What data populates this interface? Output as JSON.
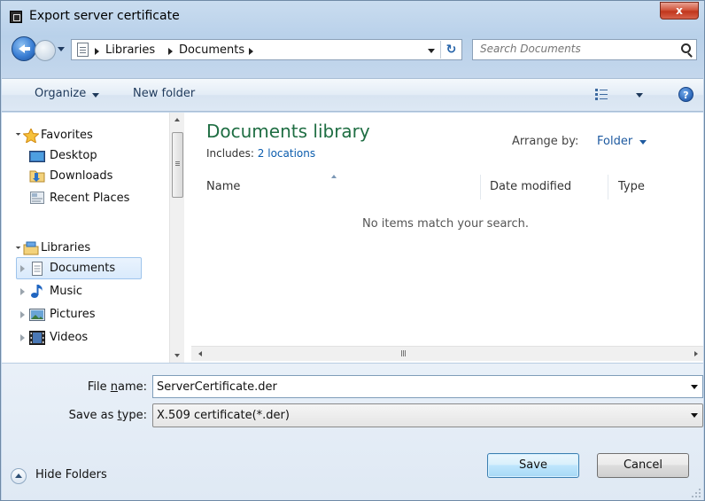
{
  "window": {
    "title": "Export server certificate",
    "close_label": "x"
  },
  "address_bar": {
    "crumbs": [
      "Libraries",
      "Documents"
    ]
  },
  "search": {
    "placeholder": "Search Documents"
  },
  "toolbar": {
    "organize_label": "Organize",
    "new_folder_label": "New folder",
    "help_label": "?"
  },
  "nav_pane": {
    "favorites_label": "Favorites",
    "favorites": [
      {
        "label": "Desktop",
        "icon": "desktop-icon"
      },
      {
        "label": "Downloads",
        "icon": "downloads-folder-icon"
      },
      {
        "label": "Recent Places",
        "icon": "recent-places-icon"
      }
    ],
    "libraries_label": "Libraries",
    "libraries": [
      {
        "label": "Documents",
        "icon": "documents-icon",
        "selected": true
      },
      {
        "label": "Music",
        "icon": "music-icon"
      },
      {
        "label": "Pictures",
        "icon": "pictures-icon"
      },
      {
        "label": "Videos",
        "icon": "videos-icon"
      }
    ]
  },
  "main_pane": {
    "title": "Documents library",
    "includes_prefix": "Includes: ",
    "includes_link": "2 locations",
    "arrange_label": "Arrange by:",
    "arrange_value": "Folder",
    "columns": [
      "Name",
      "Date modified",
      "Type"
    ],
    "empty_message": "No items match your search.",
    "scroll_grip_label": "III"
  },
  "form": {
    "file_name_label_pre": "File ",
    "file_name_label_mnemonic": "n",
    "file_name_label_post": "ame:",
    "file_name_value": "ServerCertificate.der",
    "save_type_label_pre": "Save as ",
    "save_type_label_mnemonic": "t",
    "save_type_label_post": "ype:",
    "save_type_value": "X.509 certificate(*.der)"
  },
  "footer": {
    "hide_folders_label": "Hide Folders",
    "save_label": "Save",
    "cancel_label": "Cancel"
  },
  "colors": {
    "title_green": "#1f6e43",
    "link_blue": "#0b5cad",
    "close_red": "#c1361c",
    "selection_blue": "#d9eafc"
  }
}
